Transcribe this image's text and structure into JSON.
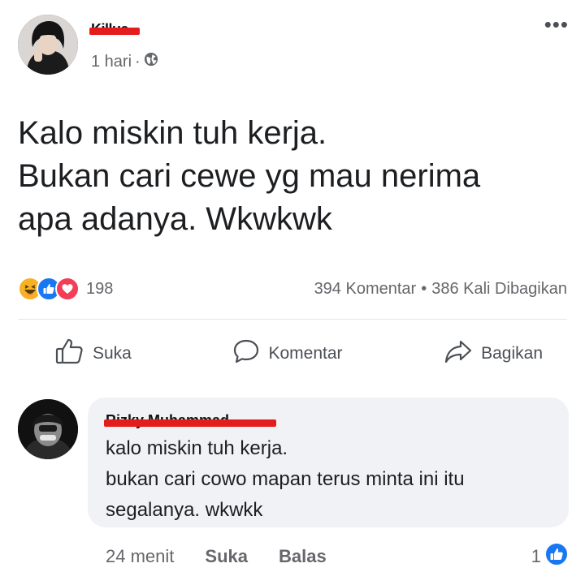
{
  "post": {
    "author_name": "Killua",
    "time": "1 hari",
    "separator": "·",
    "privacy_icon": "globe-icon",
    "more_icon": "more-dots-icon",
    "text_lines": [
      "Kalo miskin tuh kerja.",
      "Bukan cari cewe yg mau nerima",
      "apa adanya. Wkwkwk"
    ]
  },
  "stats": {
    "reaction_icons": [
      "haha-icon",
      "like-icon",
      "love-icon"
    ],
    "reaction_count": "198",
    "comments": "394 Komentar",
    "dot": "•",
    "shares": "386 Kali Dibagikan"
  },
  "actions": {
    "like_label": "Suka",
    "comment_label": "Komentar",
    "share_label": "Bagikan"
  },
  "comment": {
    "author_name": "Rizky Muhammad",
    "text_lines": [
      "kalo miskin tuh kerja.",
      "bukan cari cowo mapan terus minta ini itu",
      "segalanya. wkwkk"
    ],
    "time": "24 menit",
    "like_label": "Suka",
    "reply_label": "Balas",
    "like_count": "1"
  },
  "colors": {
    "redaction": "#e41c1c",
    "like_blue": "#1877f2",
    "love_red": "#f33e58",
    "haha_yellow": "#f7b125",
    "muted": "#65676b"
  }
}
